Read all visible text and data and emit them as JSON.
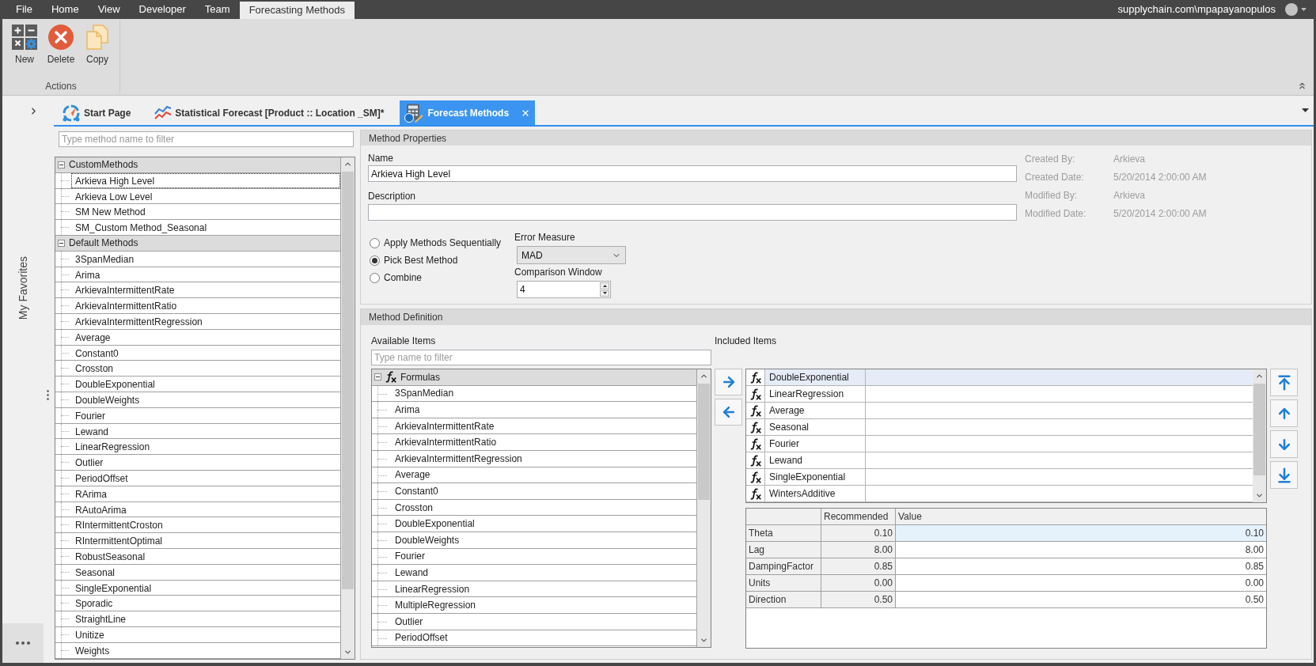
{
  "menu_bar": {
    "items": [
      {
        "label": "File",
        "selected": false
      },
      {
        "label": "Home",
        "selected": false
      },
      {
        "label": "View",
        "selected": false
      },
      {
        "label": "Developer",
        "selected": false
      },
      {
        "label": "Team",
        "selected": false
      },
      {
        "label": "Forecasting Methods",
        "selected": true
      }
    ],
    "user": "supplychain.com\\mpapayanopulos"
  },
  "ribbon": {
    "groups": [
      {
        "label": "Actions",
        "buttons": [
          {
            "kind": "new",
            "label": "New"
          },
          {
            "kind": "delete",
            "label": "Delete"
          },
          {
            "kind": "copy",
            "label": "Copy"
          }
        ]
      }
    ]
  },
  "document_tabs": [
    {
      "kind": "start",
      "label": "Start Page",
      "selected": false
    },
    {
      "kind": "chart",
      "label": "Statistical Forecast [Product :: Location _SM]*",
      "selected": false
    },
    {
      "kind": "calculator",
      "label": "Forecast Methods",
      "selected": true
    }
  ],
  "favorites_sidebar": {
    "title": "My Favorites"
  },
  "method_list": {
    "placeholder": "Type method name to filter",
    "groups": [
      {
        "label": "CustomMethods",
        "expanded": true,
        "children": [
          {
            "label": "Arkieva High Level",
            "selected": true
          },
          {
            "label": "Arkieva Low Level",
            "selected": false
          },
          {
            "label": "SM New Method",
            "selected": false
          },
          {
            "label": "SM_Custom Method_Seasonal",
            "selected": false
          }
        ]
      },
      {
        "label": "Default Methods",
        "expanded": true,
        "children": [
          {
            "label": "3SpanMedian",
            "selected": false
          },
          {
            "label": "Arima",
            "selected": false
          },
          {
            "label": "ArkievaIntermittentRate",
            "selected": false
          },
          {
            "label": "ArkievaIntermittentRatio",
            "selected": false
          },
          {
            "label": "ArkievaIntermittentRegression",
            "selected": false
          },
          {
            "label": "Average",
            "selected": false
          },
          {
            "label": "Constant0",
            "selected": false
          },
          {
            "label": "Crosston",
            "selected": false
          },
          {
            "label": "DoubleExponential",
            "selected": false
          },
          {
            "label": "DoubleWeights",
            "selected": false
          },
          {
            "label": "Fourier",
            "selected": false
          },
          {
            "label": "Lewand",
            "selected": false
          },
          {
            "label": "LinearRegression",
            "selected": false
          },
          {
            "label": "Outlier",
            "selected": false
          },
          {
            "label": "PeriodOffset",
            "selected": false
          },
          {
            "label": "RArima",
            "selected": false
          },
          {
            "label": "RAutoArima",
            "selected": false
          },
          {
            "label": "RIntermittentCroston",
            "selected": false
          },
          {
            "label": "RIntermittentOptimal",
            "selected": false
          },
          {
            "label": "RobustSeasonal",
            "selected": false
          },
          {
            "label": "Seasonal",
            "selected": false
          },
          {
            "label": "SingleExponential",
            "selected": false
          },
          {
            "label": "Sporadic",
            "selected": false
          },
          {
            "label": "StraightLine",
            "selected": false
          },
          {
            "label": "Unitize",
            "selected": false
          },
          {
            "label": "Weights",
            "selected": false
          }
        ]
      }
    ]
  },
  "method_properties": {
    "title": "Method Properties",
    "name": {
      "label": "Name",
      "value": "Arkieva High Level"
    },
    "description": {
      "label": "Description"
    },
    "audit": [
      {
        "label": "Created By:",
        "value": "Arkieva"
      },
      {
        "label": "Created Date:",
        "value": "5/20/2014 2:00:00 AM"
      },
      {
        "label": "Modified By:",
        "value": "Arkieva"
      },
      {
        "label": "Modified Date:",
        "value": "5/20/2014 2:00:00 AM"
      }
    ],
    "modes": [
      {
        "label": "Apply Methods Sequentially",
        "selected": false
      },
      {
        "label": "Pick Best Method",
        "selected": true
      },
      {
        "label": "Combine",
        "selected": false
      }
    ],
    "error_measure": {
      "label": "Error Measure",
      "value": "MAD"
    },
    "comparison_window": {
      "label": "Comparison Window",
      "value": "4"
    }
  },
  "method_definition": {
    "title": "Method Definition",
    "available": {
      "label": "Available Items",
      "placeholder": "Type name to filter",
      "groups": [
        {
          "label": "Formulas",
          "expanded": true,
          "children": [
            {
              "label": "3SpanMedian"
            },
            {
              "label": "Arima"
            },
            {
              "label": "ArkievaIntermittentRate"
            },
            {
              "label": "ArkievaIntermittentRatio"
            },
            {
              "label": "ArkievaIntermittentRegression"
            },
            {
              "label": "Average"
            },
            {
              "label": "Constant0"
            },
            {
              "label": "Crosston"
            },
            {
              "label": "DoubleExponential"
            },
            {
              "label": "DoubleWeights"
            },
            {
              "label": "Fourier"
            },
            {
              "label": "Lewand"
            },
            {
              "label": "LinearRegression"
            },
            {
              "label": "MultipleRegression"
            },
            {
              "label": "Outlier"
            },
            {
              "label": "PeriodOffset"
            }
          ]
        }
      ]
    },
    "included": {
      "label": "Included Items",
      "rows": [
        {
          "label": "DoubleExponential",
          "selected": true
        },
        {
          "label": "LinearRegression",
          "selected": false
        },
        {
          "label": "Average",
          "selected": false
        },
        {
          "label": "Seasonal",
          "selected": false
        },
        {
          "label": "Fourier",
          "selected": false
        },
        {
          "label": "Lewand",
          "selected": false
        },
        {
          "label": "SingleExponential",
          "selected": false
        },
        {
          "label": "WintersAdditive",
          "selected": false
        }
      ]
    },
    "parameters": {
      "columns": [
        "Recommended",
        "Value"
      ],
      "rows": [
        {
          "name": "Theta",
          "recommended": "0.10",
          "value": "0.10",
          "selected": true
        },
        {
          "name": "Lag",
          "recommended": "8.00",
          "value": "8.00",
          "selected": false
        },
        {
          "name": "DampingFactor",
          "recommended": "0.85",
          "value": "0.85",
          "selected": false
        },
        {
          "name": "Units",
          "recommended": "0.00",
          "value": "0.00",
          "selected": false
        },
        {
          "name": "Direction",
          "recommended": "0.50",
          "value": "0.50",
          "selected": false
        }
      ]
    }
  }
}
